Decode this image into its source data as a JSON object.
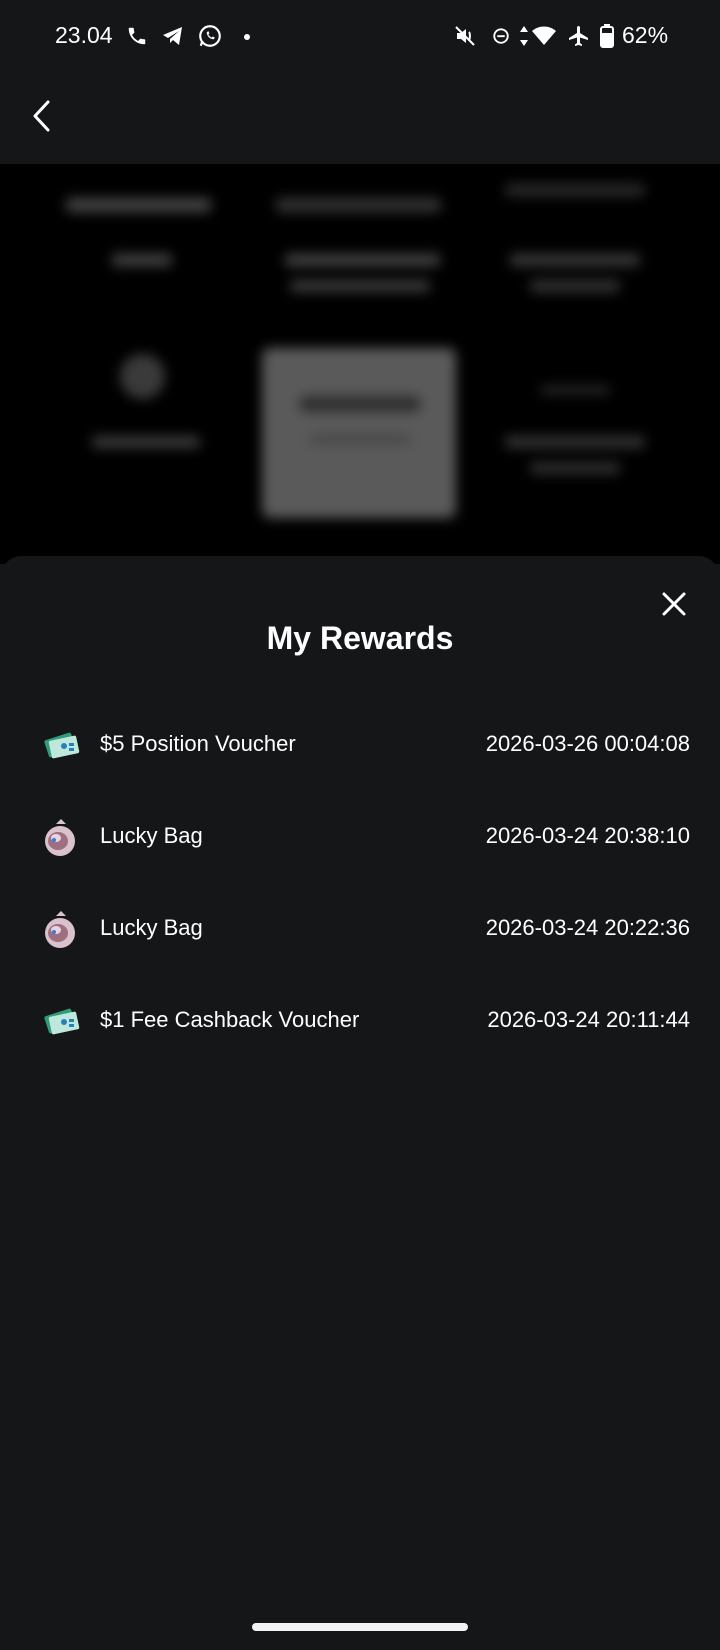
{
  "status_bar": {
    "time": "23.04",
    "battery": "62%",
    "icons": [
      "phone-icon",
      "telegram-icon",
      "whatsapp-icon",
      "dot-icon",
      "mute-icon",
      "dnd-icon",
      "data-arrows-icon",
      "wifi-icon",
      "airplane-icon",
      "battery-icon"
    ]
  },
  "header": {
    "back_icon": "chevron-left-icon"
  },
  "sheet": {
    "title": "My Rewards",
    "close_icon": "close-icon",
    "rewards": [
      {
        "name": "$5 Position Voucher",
        "time": "2026-03-26 00:04:08",
        "icon": "voucher-icon"
      },
      {
        "name": "Lucky Bag",
        "time": "2026-03-24 20:38:10",
        "icon": "lucky-bag-icon"
      },
      {
        "name": "Lucky Bag",
        "time": "2026-03-24 20:22:36",
        "icon": "lucky-bag-icon"
      },
      {
        "name": "$1 Fee Cashback Voucher",
        "time": "2026-03-24 20:11:44",
        "icon": "voucher-icon"
      }
    ]
  },
  "colors": {
    "background": "#151618",
    "overlay": "#000000",
    "text": "#ffffff",
    "voucher_green": "#3fbf8f",
    "bag_pink": "#c9a7b4"
  }
}
